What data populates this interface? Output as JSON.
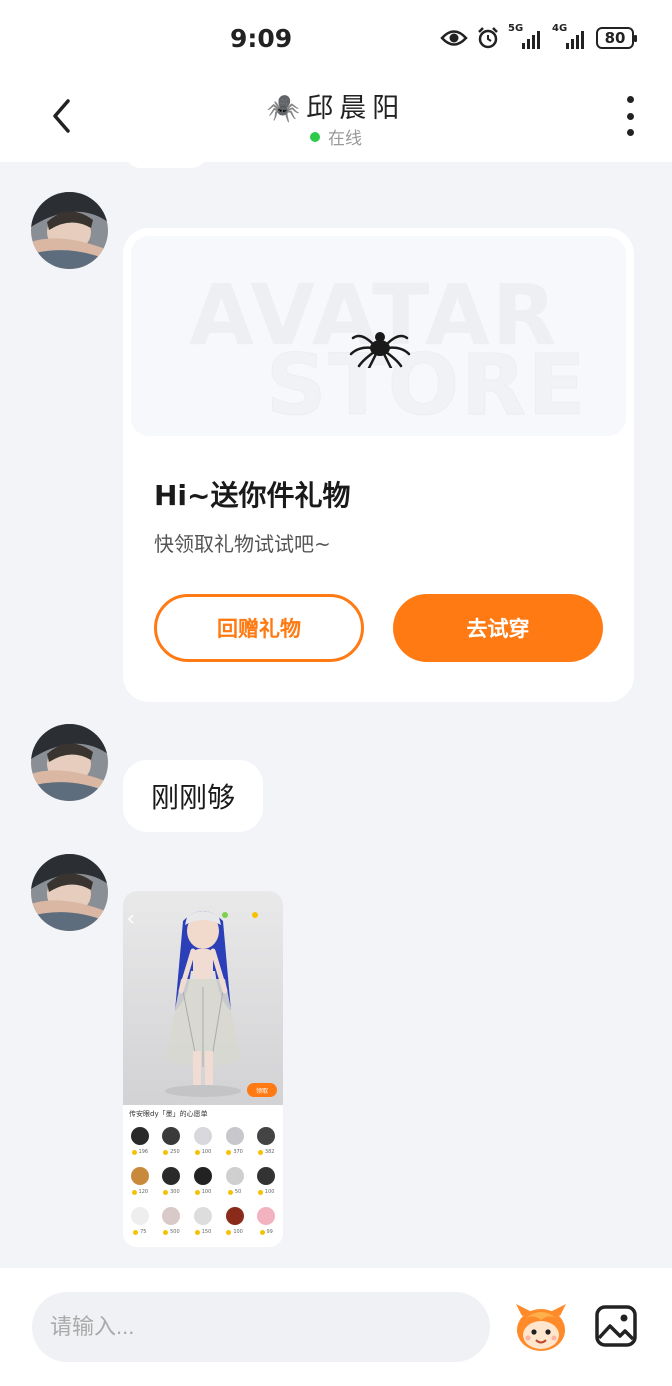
{
  "status_bar": {
    "time": "9:09",
    "signal1_label": "5G",
    "signal2_label": "4G",
    "battery": "80"
  },
  "header": {
    "contact_name": "🕷️邱晨阳",
    "status": "在线"
  },
  "gift_card": {
    "banner_word_top": "AVATAR",
    "banner_word_bottom": "STORE",
    "title": "Hi~送你件礼物",
    "subtitle": "快领取礼物试试吧~",
    "return_gift_label": "回赠礼物",
    "try_on_label": "去试穿"
  },
  "text_message": {
    "text": "刚刚够"
  },
  "image_message": {
    "caption": "传安眼dy「墨」的心愿单",
    "tag": "领取",
    "item_prices": [
      "196",
      "250",
      "100",
      "370",
      "382",
      "120",
      "300",
      "100",
      "50",
      "100",
      "75",
      "500",
      "150",
      "100",
      "99"
    ]
  },
  "input_bar": {
    "placeholder": "请输入..."
  },
  "colors": {
    "accent": "#ff7a12",
    "online": "#2ec94a",
    "background": "#f2f4f8"
  }
}
